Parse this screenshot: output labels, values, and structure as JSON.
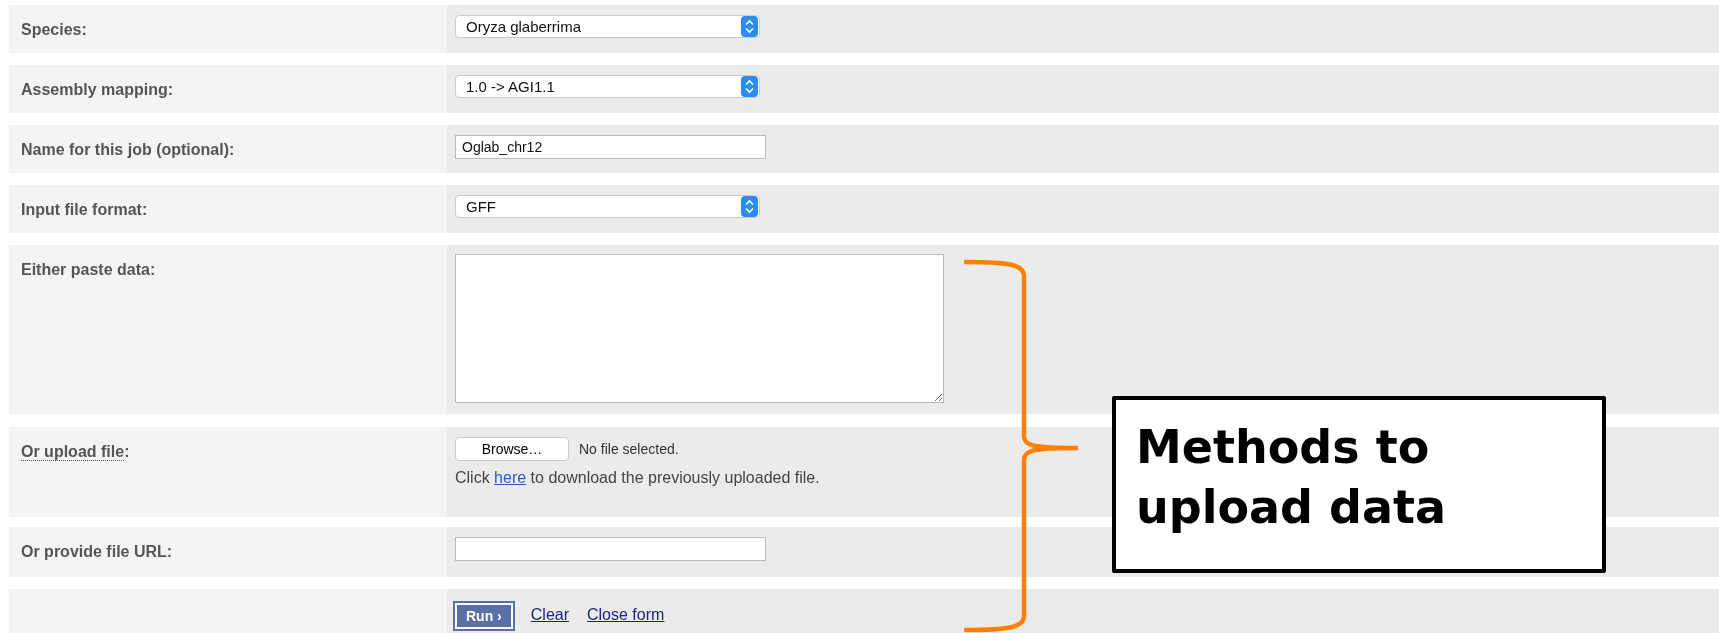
{
  "form": {
    "rows": [
      {
        "kind": "select",
        "label": "Species:",
        "value": "Oryza glaberrima"
      },
      {
        "kind": "select",
        "label": "Assembly mapping:",
        "value": "1.0 -> AGI1.1"
      },
      {
        "kind": "text",
        "label": "Name for this job (optional):",
        "value": "Oglab_chr12"
      },
      {
        "kind": "select",
        "label": "Input file format:",
        "value": "GFF"
      },
      {
        "kind": "textarea",
        "label": "Either paste data:"
      },
      {
        "kind": "upload",
        "label": "Or upload file",
        "label_suffix": ":",
        "button": "Browse…",
        "status": "No file selected.",
        "note_before": "Click ",
        "link": "here",
        "note_after": " to download the previously uploaded file."
      },
      {
        "kind": "url",
        "label": "Or provide file URL:"
      }
    ],
    "actions": {
      "run": "Run ›",
      "links": [
        "Clear",
        "Close form"
      ]
    }
  },
  "callout": {
    "text": "Methods to upload data"
  }
}
